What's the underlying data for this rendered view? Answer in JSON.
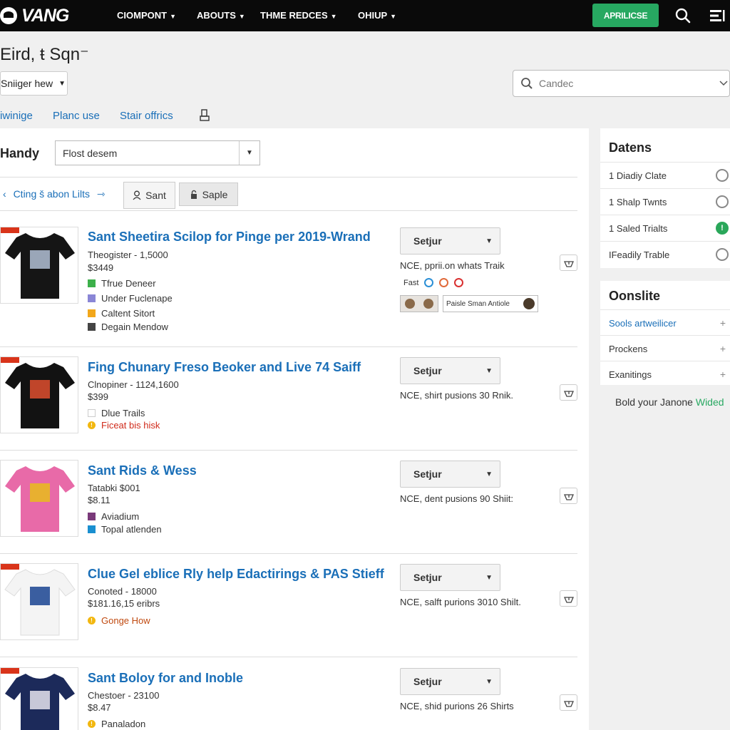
{
  "header": {
    "logo_text": "VANG",
    "nav": [
      "CIOMPONT",
      "ABOUTS",
      "THME REDCES",
      "OHIUP"
    ],
    "apply_label": "APRILICSE",
    "search_icon": "search-icon",
    "menu_icon": "menu-icon"
  },
  "page": {
    "title": "Eird, ŧ Sqn⁻",
    "sort_label": "Sniiger hew",
    "search_placeholder": "Candec",
    "links": [
      "iwinige",
      "Planc use",
      "Stair offrics"
    ],
    "print_icon": "print-icon"
  },
  "filter": {
    "label": "Handy",
    "select_value": "Flost desem",
    "back_link": "Cting š abon Lilts",
    "tab_sant": "Sant",
    "tab_saple": "Saple"
  },
  "products": [
    {
      "title": "Sant Sheetira Scilop for Pinge per 2019-Wrand",
      "meta": "Theogister - 1,5000",
      "price": "$3449",
      "tags": [
        {
          "text": "Tfrue Deneer",
          "color": "#3cb04a"
        },
        {
          "text": "Under Fuclenape",
          "color": "#8a86d6"
        },
        {
          "text": "Caltent Sitort",
          "color": "#f2a71b"
        },
        {
          "text": "Degain Mendow",
          "color": "#444444"
        }
      ],
      "select_label": "Setjur",
      "note": "NCE, pprii.on whats Traik",
      "extra_label": "Fast",
      "strip_label": "Paisle Sman Antiole",
      "shirt_color": "#151515",
      "print_color": "#9aa6b8"
    },
    {
      "title": "Fing Chunary Freso Beoker and Live 74 Saiff",
      "meta": "Clnopiner - 1124,1600",
      "price": "$399",
      "tags": [
        {
          "text": "Dlue Trails",
          "color": "#ffffff"
        },
        {
          "text": "Ficeat bis hisk",
          "color": "warn"
        }
      ],
      "select_label": "Setjur",
      "note": "NCE, shirt pusions 30 Rnik.",
      "shirt_color": "#121212",
      "print_color": "#c0452a"
    },
    {
      "title": "Sant Rids & Wess",
      "meta": "Tatabki $001",
      "price": "$8.11",
      "tags": [
        {
          "text": "Aviadium",
          "color": "#7a3a7a"
        },
        {
          "text": "Topal atlenden",
          "color": "#1a8fd0"
        }
      ],
      "select_label": "Setjur",
      "note": "NCE, dent pusions 90 Shiit:",
      "shirt_color": "#e86aa8",
      "print_color": "#e8b030"
    },
    {
      "title": "Clue Gel eblice Rly help Edactirings & PAS Stieff",
      "meta": "Conoted - 18000",
      "price": "$181.16,15 eribrs",
      "tags": [
        {
          "text": "Gonge How",
          "color": "dot"
        }
      ],
      "select_label": "Setjur",
      "note": "NCE, salft purions 3010 Shilt.",
      "shirt_color": "#f4f4f4",
      "print_color": "#3a5ea0"
    },
    {
      "title": "Sant Boloy for and Inoble",
      "meta": "Chestoer - 23100",
      "price": "$8.47",
      "tags": [
        {
          "text": "Panaladon",
          "color": "dot"
        }
      ],
      "select_label": "Setjur",
      "note": "NCE, shid purions 26 Shirts",
      "shirt_color": "#1c2a5a",
      "print_color": "#c8c8d8"
    }
  ],
  "sidebar": {
    "dates_title": "Datens",
    "dates": [
      {
        "label": "1 Diadiy Clate",
        "state": "off"
      },
      {
        "label": "1 Shalp Twnts",
        "state": "off"
      },
      {
        "label": "1 Saled Trialts",
        "state": "on"
      },
      {
        "label": "IFeadily Trable",
        "state": "off"
      }
    ],
    "online_title": "Oonslite",
    "online": [
      {
        "label": "Sools artweilicer",
        "link": true
      },
      {
        "label": "Prockens",
        "link": false
      },
      {
        "label": "Exanitings",
        "link": false
      }
    ],
    "promo_text": "Bold your Janone",
    "promo_highlight": "Wided"
  }
}
